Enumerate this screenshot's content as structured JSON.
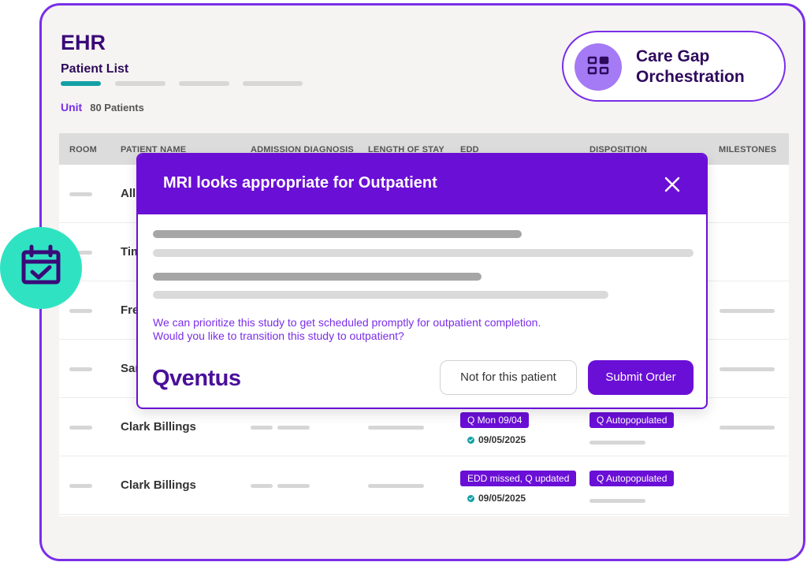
{
  "app": {
    "title": "EHR",
    "subtitle": "Patient List",
    "unit_label": "Unit",
    "patient_count": "80 Patients"
  },
  "care_gap": {
    "icon": "grid-dashboard-icon",
    "label": "Care Gap Orchestration"
  },
  "calendar_badge": {
    "icon": "calendar-check-icon"
  },
  "table": {
    "columns": [
      "ROOM",
      "PATIENT NAME",
      "ADMISSION DIAGNOSIS",
      "LENGTH OF STAY",
      "EDD",
      "DISPOSITION",
      "MILESTONES"
    ],
    "rows": [
      {
        "name": "Alli"
      },
      {
        "name": "Tim"
      },
      {
        "name": "Fre"
      },
      {
        "name": "Sar"
      },
      {
        "name": "Clark Billings",
        "edd_badge": "Q Mon 09/04",
        "edd_date": "09/05/2025",
        "disposition": "Q Autopopulated"
      },
      {
        "name": "Clark Billings",
        "edd_badge": "EDD missed, Q updated",
        "edd_date": "09/05/2025",
        "disposition": "Q Autopopulated"
      }
    ]
  },
  "modal": {
    "title": "MRI looks appropriate for Outpatient",
    "message_line1": "We can prioritize this study to get scheduled promptly for outpatient completion.",
    "message_line2": "Would you like to transition this study to outpatient?",
    "logo_text": "Qventus",
    "secondary_button": "Not for this patient",
    "primary_button": "Submit Order"
  },
  "colors": {
    "brand_purple": "#6a0fd6",
    "accent_teal": "#13a0a5",
    "badge_mint": "#2fe3c2"
  }
}
